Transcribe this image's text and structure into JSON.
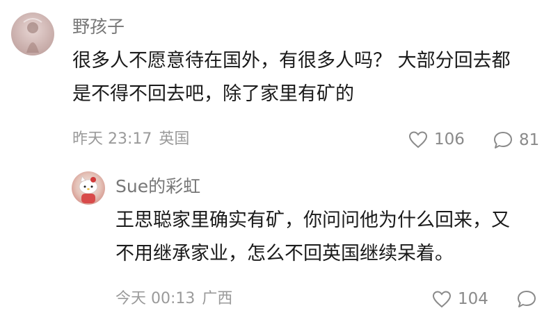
{
  "comment": {
    "username": "野孩子",
    "text_lines": [
      "很多人不愿意待在国外，有很多人吗？ 大部分回去都",
      "是不得不回去吧，除了家里有矿的"
    ],
    "time": "昨天 23:17",
    "location": "英国",
    "likes": "106",
    "replies": "81",
    "avatar_icon": "girl-photo-avatar"
  },
  "reply": {
    "username": "Sue的彩虹",
    "text_lines": [
      "王思聪家里确实有矿，你问问他为什么回来，又",
      "不用继承家业，怎么不回英国继续呆着。"
    ],
    "time": "今天 00:13",
    "location": "广西",
    "likes": "104",
    "avatar_icon": "hello-kitty-avatar"
  },
  "icons": {
    "like": "heart-outline-icon",
    "reply": "speech-bubble-icon"
  },
  "colors": {
    "text": "#1a1a1a",
    "username": "#777777",
    "meta": "#9a9a9a",
    "icon": "#8a8a8a"
  }
}
